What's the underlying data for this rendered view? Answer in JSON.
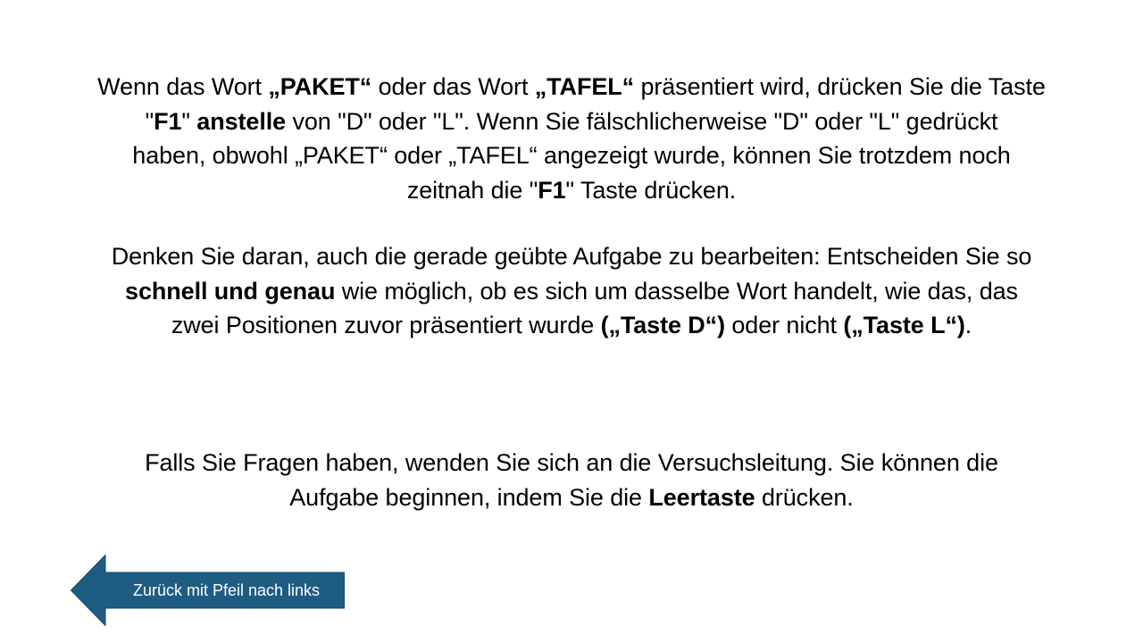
{
  "paragraph1": {
    "l1a": "Wenn das Wort ",
    "l1b": "„PAKET“",
    "l1c": " oder das Wort ",
    "l1d": "„TAFEL“",
    "l1e": " präsentiert wird, drücken Sie die Taste",
    "l2a": "\"",
    "l2b": "F1",
    "l2c": "\" ",
    "l2d": "anstelle",
    "l2e": " von \"D\" oder \"L\". Wenn Sie fälschlicherweise \"D\" oder \"L\" gedrückt",
    "l3": "haben, obwohl „PAKET“ oder „TAFEL“ angezeigt wurde, können Sie trotzdem noch",
    "l4a": "zeitnah die \"",
    "l4b": "F1",
    "l4c": "\" Taste drücken."
  },
  "paragraph2": {
    "l1": "Denken Sie daran, auch die gerade geübte Aufgabe zu bearbeiten: Entscheiden Sie so",
    "l2a": "schnell und genau",
    "l2b": " wie möglich, ob es sich um dasselbe Wort handelt, wie das, das",
    "l3a": "zwei Positionen zuvor präsentiert wurde ",
    "l3b": "(„Taste D“)",
    "l3c": " oder nicht ",
    "l3d": "(„Taste L“)",
    "l3e": "."
  },
  "paragraph3": {
    "l1": "Falls Sie Fragen haben, wenden Sie sich an die Versuchsleitung. Sie können die",
    "l2a": "Aufgabe beginnen, indem Sie die ",
    "l2b": "Leertaste",
    "l2c": " drücken."
  },
  "back_button": {
    "label": "Zurück mit Pfeil nach links",
    "icon": "left-arrow-icon",
    "fill_color": "#1F5C82",
    "border_color": "#174A6A"
  }
}
